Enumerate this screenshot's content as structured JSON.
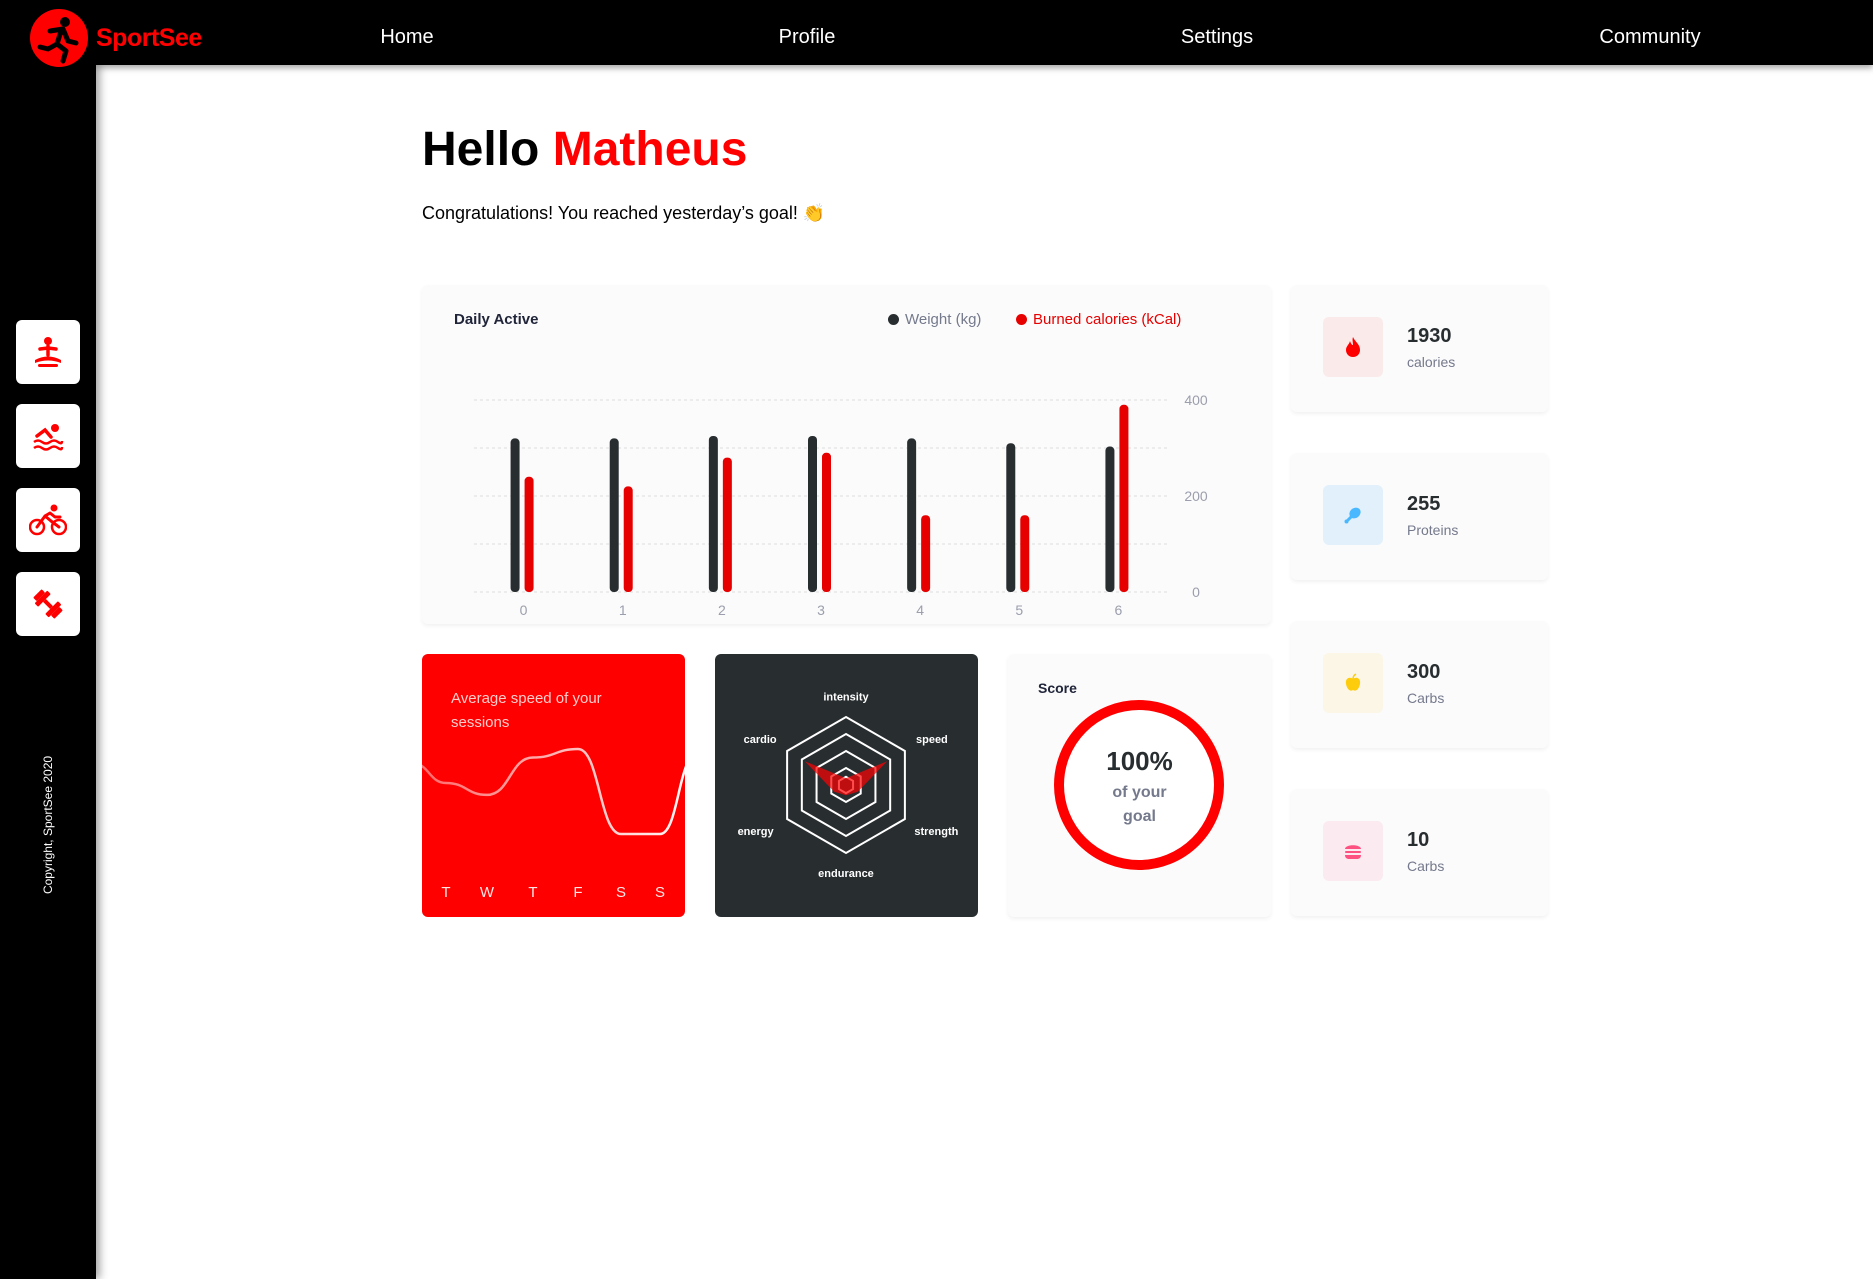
{
  "app": {
    "name": "SportSee"
  },
  "nav": [
    "Home",
    "Profile",
    "Settings",
    "Community"
  ],
  "sidebar": {
    "icons": [
      "meditation-icon",
      "swimming-icon",
      "cycling-icon",
      "dumbbell-icon"
    ],
    "copyright": "Copyright, SportSee 2020"
  },
  "greeting": {
    "hello": "Hello",
    "name": "Matheus"
  },
  "subtitle": "Congratulations! You reached yesterday’s goal! 👏",
  "colors": {
    "accent": "#ff0000",
    "dark": "#282d30"
  },
  "daily": {
    "title": "Daily Active",
    "legend": {
      "weight": "Weight (kg)",
      "calories": "Burned calories (kCal)"
    },
    "y_ticks": [
      "400",
      "200",
      "0"
    ],
    "x_ticks": [
      "0",
      "1",
      "2",
      "3",
      "4",
      "5",
      "6"
    ]
  },
  "average": {
    "title": "Average speed of your sessions",
    "days": [
      "T",
      "W",
      "T",
      "F",
      "S",
      "S"
    ]
  },
  "radar": {
    "labels": {
      "intensity": "intensity",
      "speed": "speed",
      "strength": "strength",
      "endurance": "endurance",
      "energy": "energy",
      "cardio": "cardio"
    }
  },
  "score": {
    "title": "Score",
    "value": "100%",
    "line1": "of your",
    "line2": "goal",
    "fraction": 1.0
  },
  "key_data": [
    {
      "value": "1930",
      "label": "calories",
      "icon": "flame-icon"
    },
    {
      "value": "255",
      "label": "Proteins",
      "icon": "chicken-icon"
    },
    {
      "value": "300",
      "label": "Carbs",
      "icon": "apple-icon"
    },
    {
      "value": "10",
      "label": "Carbs",
      "icon": "burger-icon"
    }
  ],
  "chart_data": [
    {
      "type": "bar",
      "title": "Daily Active",
      "categories": [
        "0",
        "1",
        "2",
        "3",
        "4",
        "5",
        "6"
      ],
      "series": [
        {
          "name": "Weight (kg)",
          "values": [
            320,
            320,
            325,
            325,
            320,
            310,
            303
          ]
        },
        {
          "name": "Burned calories (kCal)",
          "values": [
            240,
            220,
            280,
            290,
            160,
            160,
            390
          ]
        }
      ],
      "ylim": [
        0,
        400
      ],
      "y_ticks": [
        0,
        200,
        400
      ],
      "grid": true,
      "legend": "top-right"
    },
    {
      "type": "line",
      "title": "Average speed of your sessions",
      "categories": [
        "T",
        "W",
        "T",
        "F",
        "S",
        "S"
      ],
      "values": [
        30,
        23,
        45,
        50,
        0,
        0
      ]
    },
    {
      "type": "radar",
      "categories": [
        "intensity",
        "speed",
        "strength",
        "endurance",
        "energy",
        "cardio"
      ],
      "values": [
        0.1,
        0.7,
        0.2,
        0.15,
        0.2,
        0.7
      ]
    }
  ]
}
